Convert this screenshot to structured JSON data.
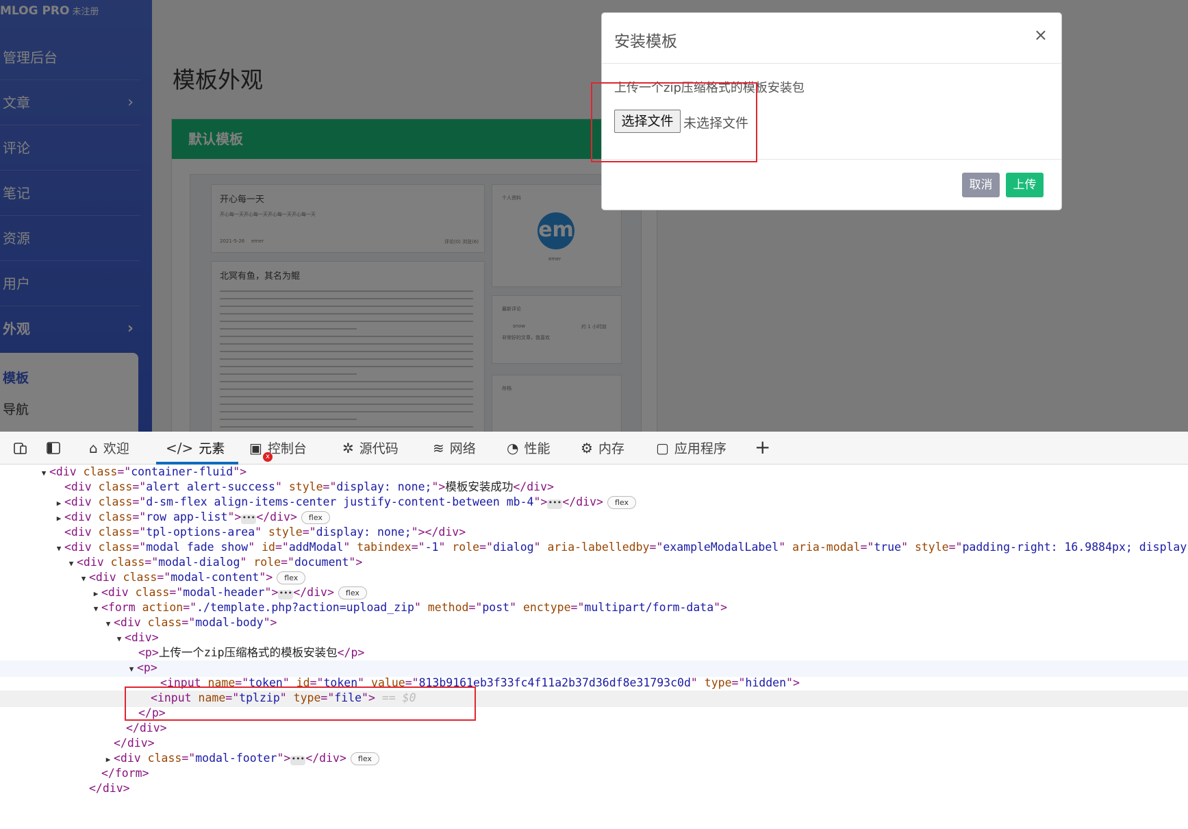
{
  "sidebar": {
    "brand": "MLOG PRO",
    "brand_badge": "未注册",
    "items": [
      {
        "label": "管理后台"
      },
      {
        "label": "文章"
      },
      {
        "label": "评论"
      },
      {
        "label": "笔记"
      },
      {
        "label": "资源"
      },
      {
        "label": "用户"
      },
      {
        "label": "外观"
      }
    ],
    "submenu": [
      {
        "label": "模板"
      },
      {
        "label": "导航"
      }
    ]
  },
  "main": {
    "page_title": "模板外观",
    "template_card": {
      "title": "默认模板",
      "preview": {
        "post1_title": "开心每一天",
        "post1_excerpt": "开心每一天开心每一天开心每一天开心每一天",
        "post1_date": "2021-5-26",
        "post1_author": "emer",
        "post1_meta": "评论(0)  浏览(6)",
        "post2_title": "北冥有鱼，其名为鲲",
        "profile_label": "个人资料",
        "avatar_text": "em",
        "profile_name": "emer",
        "recent_comments_label": "最新评论",
        "comment_user": "snow",
        "comment_time": "约 1 小时前",
        "comment_text": "非常好的文章，我喜欢",
        "archive_label": "存档"
      }
    }
  },
  "modal": {
    "title": "安装模板",
    "close": "×",
    "description": "上传一个zip压缩格式的模板安装包",
    "file_button": "选择文件",
    "file_status": "未选择文件",
    "cancel": "取消",
    "upload": "上传"
  },
  "devtools": {
    "tabs": [
      {
        "label": "欢迎",
        "icon": "home-icon"
      },
      {
        "label": "元素",
        "icon": "code-icon"
      },
      {
        "label": "控制台",
        "icon": "console-icon"
      },
      {
        "label": "源代码",
        "icon": "bug-icon"
      },
      {
        "label": "网络",
        "icon": "wifi-icon"
      },
      {
        "label": "性能",
        "icon": "gauge-icon"
      },
      {
        "label": "内存",
        "icon": "chip-icon"
      },
      {
        "label": "应用程序",
        "icon": "window-icon"
      }
    ],
    "active_tab": "元素",
    "error_badge": "x",
    "plus": "+",
    "dom_lines": {
      "l1_attr": "class",
      "l1_val": "container-fluid",
      "l2_class": "alert alert-success",
      "l2_style": "display: none;",
      "l2_text": "模板安装成功",
      "l3_class": "d-sm-flex align-items-center justify-content-between mb-4",
      "l4_class": "row app-list",
      "l5_class": "tpl-options-area",
      "l5_style": "display: none;",
      "l6_class": "modal fade show",
      "l6_id": "addModal",
      "l6_tabindex": "-1",
      "l6_role": "dialog",
      "l6_labelledby": "exampleModalLabel",
      "l6_ariamodal": "true",
      "l6_style": "padding-right: 16.9884px; display:",
      "l7_class": "modal-dialog",
      "l7_role": "document",
      "l8_class": "modal-content",
      "l9_class": "modal-header",
      "l10_action": "./template.php?action=upload_zip",
      "l10_method": "post",
      "l10_enctype": "multipart/form-data",
      "l11_class": "modal-body",
      "l13_text": "上传一个zip压缩格式的模板安装包",
      "l15_name": "token",
      "l15_id": "token",
      "l15_value": "813b9161eb3f33fc4f11a2b37d36df8e31793c0d",
      "l15_type": "hidden",
      "l16_name": "tplzip",
      "l16_type": "file",
      "l16_ref": "== $0",
      "l20_class": "modal-footer",
      "flex": "flex",
      "dots": "•••"
    }
  }
}
